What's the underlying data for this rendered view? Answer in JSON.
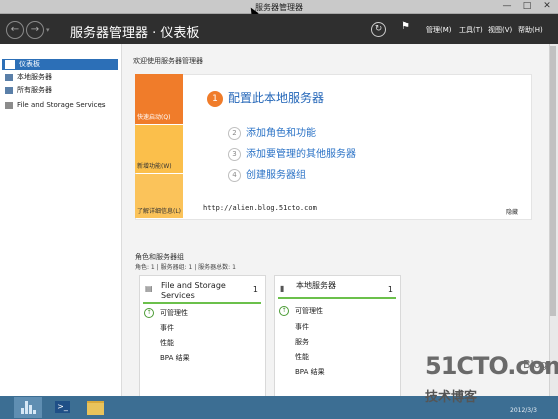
{
  "window": {
    "title": "服务器管理器",
    "controls": [
      "—",
      "□",
      "✕"
    ]
  },
  "header": {
    "crumb": "服务器管理器 · 仪表板",
    "menus": [
      "管理(M)",
      "工具(T)",
      "视图(V)",
      "帮助(H)"
    ]
  },
  "sidebar": {
    "items": [
      {
        "label": "仪表板",
        "icon": "dashboard-icon",
        "active": true
      },
      {
        "label": "本地服务器",
        "icon": "server-icon",
        "active": false
      },
      {
        "label": "所有服务器",
        "icon": "servers-icon",
        "active": false
      },
      {
        "label": "File and Storage Services",
        "icon": "storage-icon",
        "active": false,
        "chevron": "▷"
      }
    ]
  },
  "welcome": {
    "title": "欢迎使用服务器管理器",
    "tiles": [
      "快速启动(Q)",
      "新增功能(W)",
      "了解详细信息(L)"
    ],
    "steps": [
      {
        "num": "1",
        "label": "配置此本地服务器"
      },
      {
        "num": "2",
        "label": "添加角色和功能"
      },
      {
        "num": "3",
        "label": "添加要管理的其他服务器"
      },
      {
        "num": "4",
        "label": "创建服务器组"
      }
    ],
    "watermark_url": "http://alien.blog.51cto.com",
    "hide_label": "隐藏"
  },
  "roles": {
    "title": "角色和服务器组",
    "subtitle": "角色: 1 | 服务器组: 1 | 服务器总数: 1",
    "cards": [
      {
        "title": "File and Storage Services",
        "count": "1",
        "icon": "storage-icon",
        "rows": [
          "可管理性",
          "事件",
          "性能",
          "BPA 结果"
        ]
      },
      {
        "title": "本地服务器",
        "count": "1",
        "icon": "server-icon",
        "rows": [
          "可管理性",
          "事件",
          "服务",
          "性能",
          "BPA 结果"
        ]
      }
    ]
  },
  "taskbar": {
    "date": "2012/3/3"
  },
  "watermark": {
    "brand": "51CTO.com",
    "blog": "Blog",
    "cn": "技术博客"
  },
  "colors": {
    "accent": "#2c6fb7",
    "orange": "#f07c2a",
    "ok": "#6bc04b",
    "header": "#2f2f2f"
  }
}
